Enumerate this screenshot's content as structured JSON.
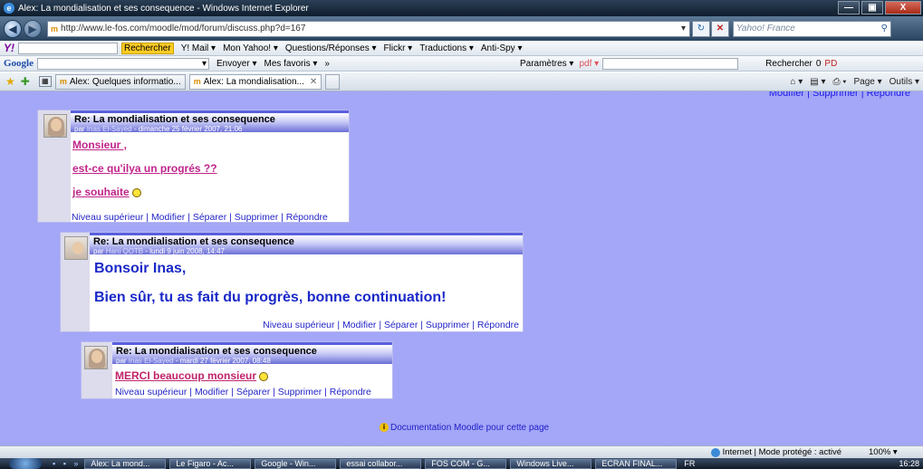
{
  "window": {
    "title": "Alex: La mondialisation et ses consequence - Windows Internet Explorer",
    "minimize": "—",
    "maximize": "▣",
    "close": "X"
  },
  "address": {
    "url": "http://www.le-fos.com/moodle/mod/forum/discuss.php?d=167",
    "search_placeholder": "Yahoo! France"
  },
  "yahoo_toolbar": {
    "logo": "Y!",
    "search_button": "Rechercher",
    "items": [
      "Y! Mail ▾",
      "Mon Yahoo! ▾",
      "Questions/Réponses ▾",
      "Flickr ▾",
      "Traductions ▾",
      "Anti-Spy ▾"
    ]
  },
  "google_toolbar": {
    "logo": "Google",
    "items": [
      "Envoyer ▾",
      "Mes favoris ▾",
      "»"
    ],
    "settings": "Paramètres ▾",
    "pdf": "pdf ▾",
    "search_button": "Rechercher",
    "count": "0",
    "pdf_right": "PD"
  },
  "tabs": [
    {
      "label": "Alex: Quelques informatio..."
    },
    {
      "label": "Alex: La mondialisation..."
    }
  ],
  "command_bar": {
    "page": "Page ▾",
    "tools": "Outils ▾"
  },
  "top_cut_links": "Modifier | Supprimer | Répondre",
  "posts": [
    {
      "subject": "Re: La mondialisation et ses consequence",
      "by": "par",
      "author": "Inas El-Sayed",
      "date": "- dimanche 25 février 2007, 21:06",
      "lines": [
        "Monsieur ,",
        "est-ce qu'ilya un progrés ??",
        "je souhaite"
      ],
      "commands": "Niveau supérieur | Modifier | Séparer | Supprimer | Répondre"
    },
    {
      "subject": "Re: La mondialisation et ses consequence",
      "by": "par",
      "author": "Hani QOTB",
      "date": "- lundi 9 juin 2008, 14:47",
      "lines": [
        "Bonsoir Inas,",
        "Bien sûr, tu as fait du progrès, bonne continuation!"
      ],
      "commands": "Niveau supérieur | Modifier | Séparer | Supprimer | Répondre"
    },
    {
      "subject": "Re: La mondialisation et ses consequence",
      "by": "par",
      "author": "Inas El-Sayed",
      "date": "- mardi 27 février 2007, 08:48",
      "lines": [
        "MERCI beaucoup monsieur"
      ],
      "commands": "Niveau supérieur | Modifier | Séparer | Supprimer | Répondre"
    }
  ],
  "doc_link": "Documentation Moodle pour cette page",
  "status": {
    "zone": "Internet | Mode protégé : activé",
    "zoom": "100% ▾"
  },
  "taskbar": {
    "tasks": [
      "Alex: La mond...",
      "Le Figaro - Ac...",
      "Google - Win...",
      "essai collabor...",
      "FOS COM - G...",
      "Windows Live...",
      "ECRAN FINAL..."
    ],
    "lang": "FR",
    "clock": "16:28"
  }
}
